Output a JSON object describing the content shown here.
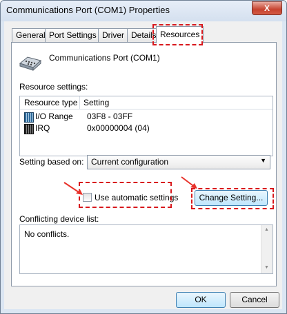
{
  "window": {
    "title": "Communications Port (COM1) Properties",
    "close_glyph": "X"
  },
  "tabs": [
    {
      "label": "General"
    },
    {
      "label": "Port Settings"
    },
    {
      "label": "Driver"
    },
    {
      "label": "Details"
    },
    {
      "label": "Resources"
    }
  ],
  "device": {
    "name": "Communications Port (COM1)",
    "icon": "serial-port-icon"
  },
  "resources": {
    "section_label": "Resource settings:",
    "columns": [
      "Resource type",
      "Setting"
    ],
    "rows": [
      {
        "type": "I/O Range",
        "setting": "03F8 - 03FF",
        "icon": "io-range-icon"
      },
      {
        "type": "IRQ",
        "setting": "0x00000004 (04)",
        "icon": "irq-icon"
      }
    ]
  },
  "setting_based_on": {
    "label": "Setting based on:",
    "value": "Current configuration"
  },
  "auto_settings": {
    "label": "Use automatic settings",
    "checked": false
  },
  "change_setting_button": "Change Setting...",
  "conflicts": {
    "label": "Conflicting device list:",
    "text": "No conflicts."
  },
  "footer": {
    "ok": "OK",
    "cancel": "Cancel"
  },
  "colors": {
    "highlight": "#d8181c",
    "arrow": "#e8322a",
    "focus_border": "#3c7fb1"
  }
}
